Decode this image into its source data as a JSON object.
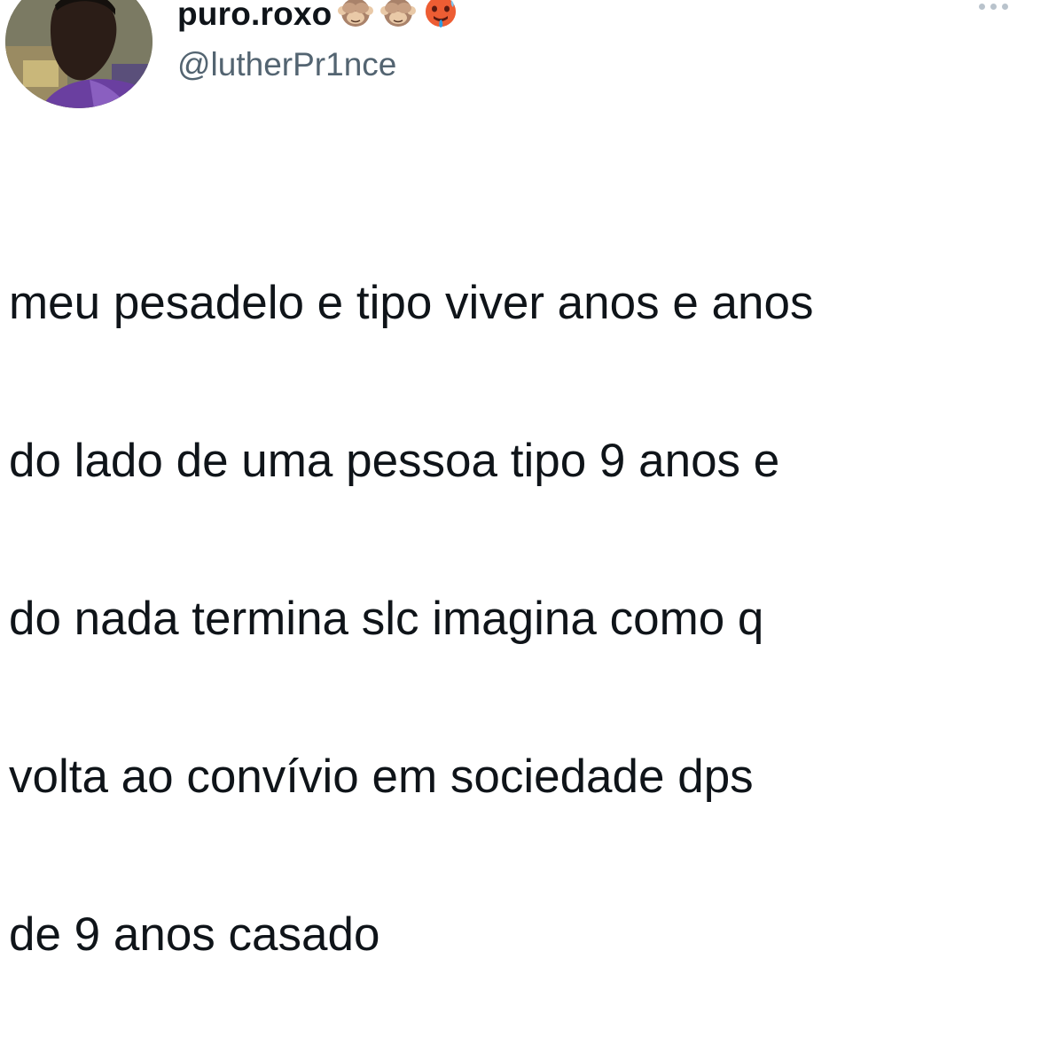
{
  "tweet": {
    "display_name": "puro.roxo",
    "handle": "@lutherPr1nce",
    "name_emojis": [
      "see-no-evil-monkey-icon",
      "see-no-evil-monkey-icon",
      "hot-face-icon"
    ],
    "lines": [
      "meu pesadelo e tipo viver anos e anos",
      "do lado de uma pessoa tipo 9 anos e",
      "do nada termina slc imagina como q",
      "volta ao convívio em sociedade dps",
      "de 9 anos casado"
    ]
  },
  "colors": {
    "text": "#0f1419",
    "secondary": "#536471",
    "more_dots": "#b9c3cc"
  }
}
